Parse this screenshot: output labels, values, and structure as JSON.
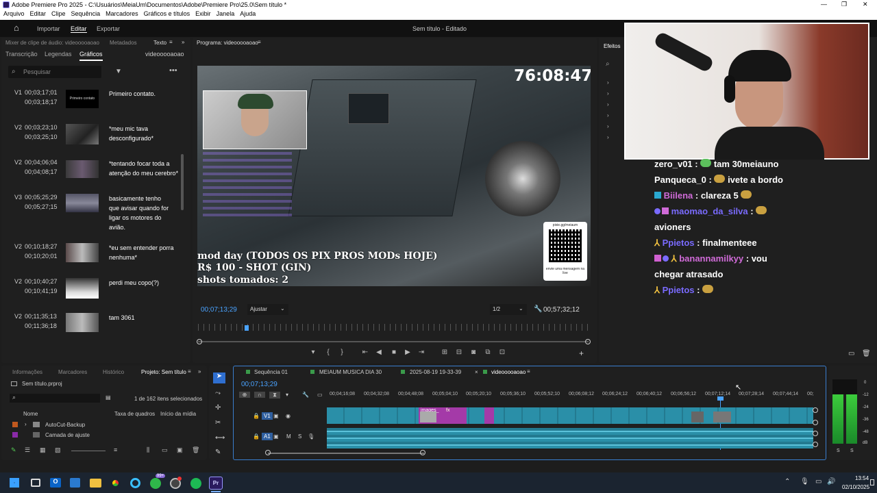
{
  "window": {
    "title": "Adobe Premiere Pro 2025 - C:\\Usuários\\MeiaUm\\Documentos\\Adobe\\Premiere Pro\\25.0\\Sem título *",
    "min": "—",
    "max": "❐",
    "close": "✕"
  },
  "menu": [
    "Arquivo",
    "Editar",
    "Clipe",
    "Sequência",
    "Marcadores",
    "Gráficos e títulos",
    "Exibir",
    "Janela",
    "Ajuda"
  ],
  "workspace": {
    "home_icon": "home-icon",
    "tabs": [
      "Importar",
      "Editar",
      "Exportar"
    ],
    "active": "Editar",
    "center": "Sem título - Editado"
  },
  "leftpanel": {
    "tabs_top": [
      "Mixer de clipe de áudio: videooooaoao",
      "Metadados",
      "Texto"
    ],
    "tabs": [
      "Transcrição",
      "Legendas",
      "Gráficos"
    ],
    "seq": "videooooaoao",
    "search_placeholder": "Pesquisar",
    "captions": [
      {
        "track": "V1",
        "t1": "00;03;17;01",
        "t2": "00;03;18;17",
        "text": "Primeiro contato."
      },
      {
        "track": "V2",
        "t1": "00;03;23;10",
        "t2": "00;03;25;10",
        "text": "*meu mic tava desconfigurado*"
      },
      {
        "track": "V2",
        "t1": "00;04;06;04",
        "t2": "00;04;08;17",
        "text": "*tentando focar toda a atenção do meu cerebro*"
      },
      {
        "track": "V3",
        "t1": "00;05;25;29",
        "t2": "00;05;27;15",
        "text": "basicamente tenho que avisar quando for ligar os motores do avião."
      },
      {
        "track": "V2",
        "t1": "00;10;18;27",
        "t2": "00;10;20;01",
        "text": "*eu sem entender porra nenhuma*"
      },
      {
        "track": "V2",
        "t1": "00;10;40;27",
        "t2": "00;10;41;19",
        "text": "perdi meu copo(?)"
      },
      {
        "track": "V2",
        "t1": "00;11;35;13",
        "t2": "00;11;36;18",
        "text": "tam 3061"
      }
    ],
    "thumb1_text": "Primeiro contato"
  },
  "program": {
    "label": "Programa: videooooaoao",
    "timer": "76:08:47",
    "overlay1": "mod day (TODOS OS PIX PROS MODs HOJE)",
    "overlay2": "R$ 100 - SHOT (GIN)",
    "overlay3": "shots tomados: 2",
    "qr_top": "pixie.gg/meiaum",
    "qr_bottom": "envie uma mensagem na live",
    "timecode": "00;07;13;29",
    "fit": "Ajustar",
    "res": "1/2",
    "duration": "00;57;32;12"
  },
  "effects": {
    "tab": "Efeitos"
  },
  "chat": [
    {
      "user": "zero_v01",
      "msg": "tam 30meiauno",
      "color": "#fff"
    },
    {
      "user": "Panqueca_0",
      "msg": "ivete a bordo",
      "color": "#fff"
    },
    {
      "user": "Biilena",
      "msg": "clareza 5",
      "color": "#d06bd8"
    },
    {
      "user": "maomao_da_silva",
      "msg": "",
      "color": "#7a6bff"
    },
    {
      "user": "",
      "msg": "avioners",
      "color": "#fff"
    },
    {
      "user": "Ppietos",
      "msg": "finalmenteee",
      "color": "#7a6bff"
    },
    {
      "user": "banannamilkyy",
      "msg": "vou",
      "color": "#d06bd8"
    },
    {
      "user": "",
      "msg": "chegar atrasado",
      "color": "#fff"
    },
    {
      "user": "Ppietos",
      "msg": "",
      "color": "#7a6bff"
    }
  ],
  "project": {
    "tabs": [
      "Informações",
      "Marcadores",
      "Histórico",
      "Projeto: Sem título"
    ],
    "file": "Sem título.prproj",
    "count": "1 de 162 itens selecionados",
    "cols": [
      "Nome",
      "Taxa de quadros",
      "Início da mídia"
    ],
    "items": [
      "AutoCut-Backup",
      "Camada de ajuste"
    ]
  },
  "timeline": {
    "tabs": [
      "Sequência 01",
      "MEIAUM MUSICA DIA 30",
      "2025-08-19 19-33-39",
      "videooooaoao"
    ],
    "timecode": "00;07;13;29",
    "ruler": [
      "00;04;16;08",
      "00;04;32;08",
      "00;04;48;08",
      "00;05;04;10",
      "00;05;20;10",
      "00;05;36;10",
      "00;05;52;10",
      "00;06;08;12",
      "00;06;24;12",
      "00;06;40;12",
      "00;06;56;12",
      "00;07;12;14",
      "00;07;28;14",
      "00;07;44;14",
      "00;"
    ],
    "v1": "V1",
    "a1": "A1",
    "clip_label": "images_"
  },
  "meter": {
    "labels": [
      "0",
      "-12",
      "-24",
      "-36",
      "-48",
      "dB"
    ],
    "ch": [
      "S",
      "S"
    ]
  },
  "taskbar": {
    "time": "13:54",
    "date": "02/10/2025",
    "badge": "99+"
  }
}
